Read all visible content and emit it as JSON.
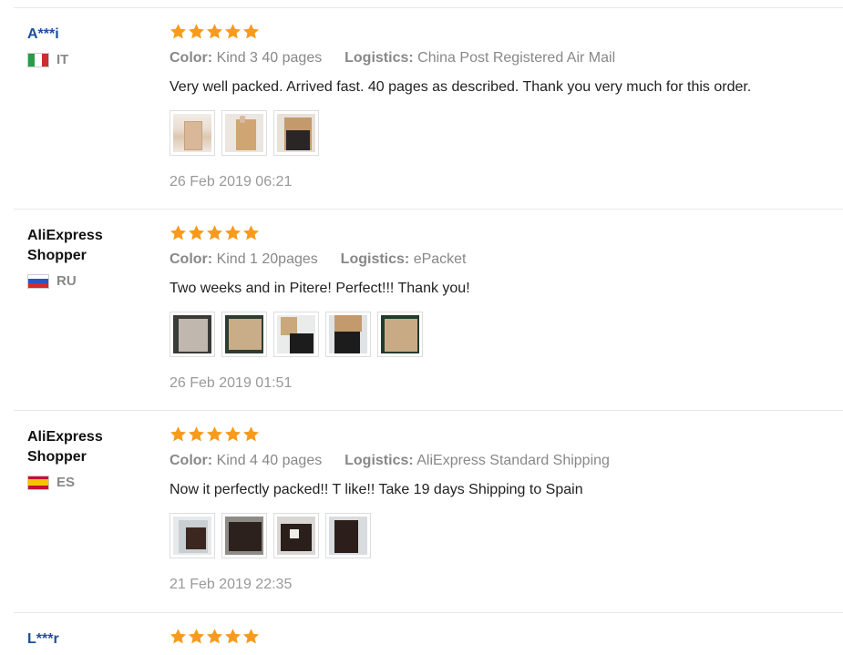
{
  "reviews": [
    {
      "user": "A***i",
      "country": "IT",
      "rating": 5,
      "color_label": "Color:",
      "color_value": "Kind 3 40 pages",
      "logistics_label": "Logistics:",
      "logistics_value": "China Post Registered Air Mail",
      "text": "Very well packed. Arrived fast. 40 pages as described. Thank you very much for this order.",
      "photos": 3,
      "date": "26 Feb 2019 06:21"
    },
    {
      "user": "AliExpress Shopper",
      "country": "RU",
      "rating": 5,
      "color_label": "Color:",
      "color_value": "Kind 1 20pages",
      "logistics_label": "Logistics:",
      "logistics_value": "ePacket",
      "text": "Two weeks and in Pitere! Perfect!!! Thank you!",
      "photos": 5,
      "date": "26 Feb 2019 01:51"
    },
    {
      "user": "AliExpress Shopper",
      "country": "ES",
      "rating": 5,
      "color_label": "Color:",
      "color_value": "Kind 4 40 pages",
      "logistics_label": "Logistics:",
      "logistics_value": "AliExpress Standard Shipping",
      "text": "Now it perfectly packed!! T like!! Take 19 days Shipping to Spain",
      "photos": 4,
      "date": "21 Feb 2019 22:35"
    },
    {
      "user": "L***r",
      "rating": 5
    }
  ],
  "colors": {
    "star": "#f89a1c",
    "username_link": "#1a4fa0"
  }
}
